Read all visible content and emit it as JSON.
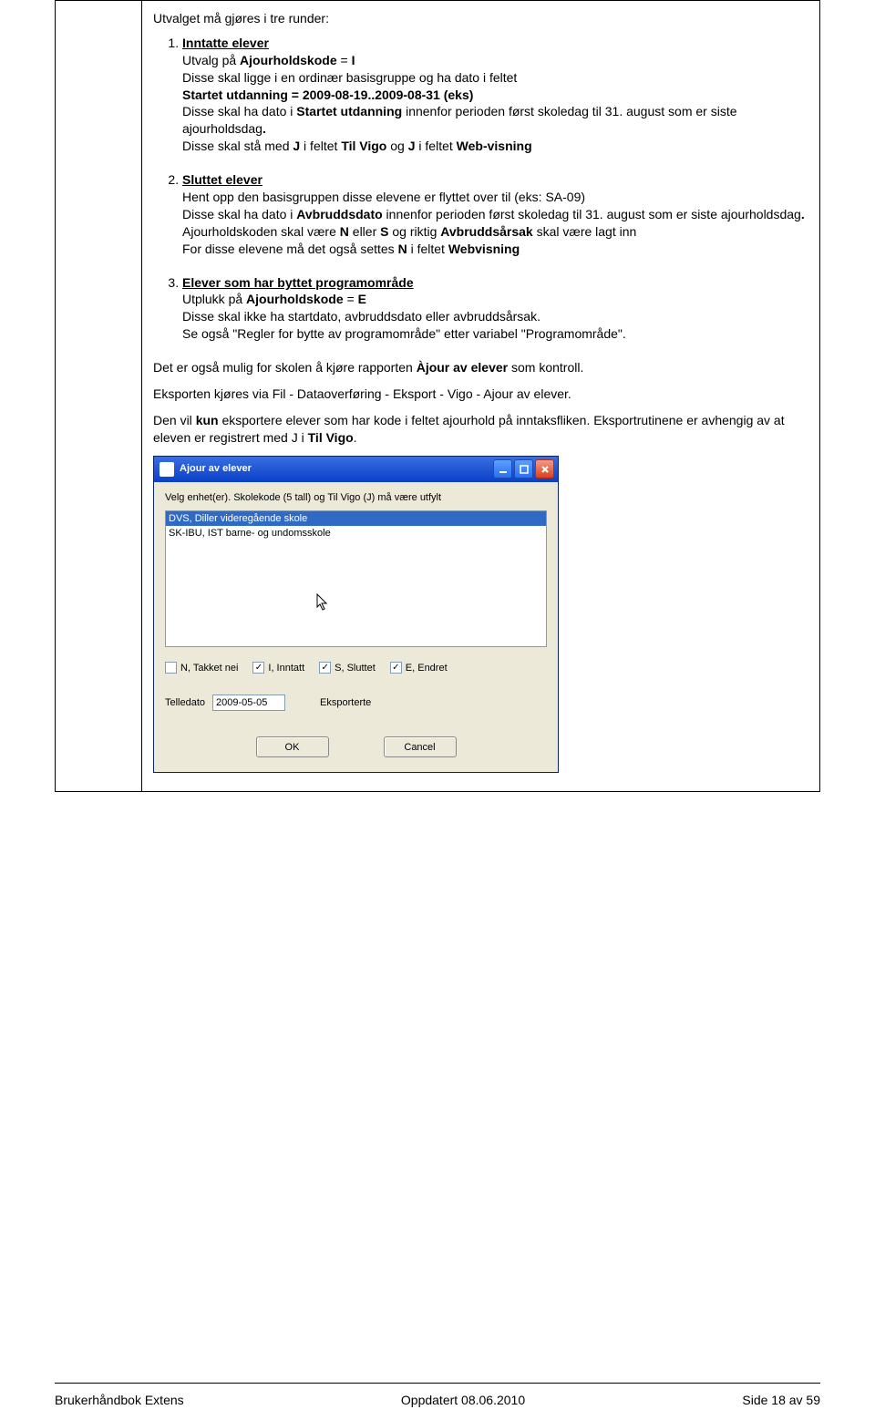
{
  "content": {
    "heading": "Utvalget må gjøres i tre runder:",
    "items": [
      {
        "title": "Inntatte elever",
        "lines": [
          "Utvalg på <b>Ajourholdskode</b>  =  <b>I</b>",
          "Disse skal ligge i en ordinær basisgruppe og ha dato i feltet",
          "<b>Startet utdanning = 2009-08-19..2009-08-31 (eks)</b>",
          "Disse skal ha dato i <b>Startet utdanning</b> innenfor perioden først skoledag til 31. august som er siste ajourholdsdag<b>.</b>",
          "Disse skal stå med <b>J</b> i feltet <b>Til Vigo</b> og <b>J</b> i feltet <b>Web-visning</b>"
        ]
      },
      {
        "title": "Sluttet elever",
        "lines": [
          "Hent opp den basisgruppen disse elevene er flyttet over til (eks: SA-09)",
          "Disse skal ha dato i <b>Avbruddsdato</b> innenfor perioden først skoledag til 31. august som er siste ajourholdsdag<b>.</b>",
          "Ajourholdskoden skal være <b>N</b> eller <b>S</b> og riktig <b>Avbruddsårsak</b> skal være lagt inn",
          "For disse elevene må det også settes <b>N</b> i feltet <b>Webvisning</b>"
        ]
      },
      {
        "title": "Elever som har byttet programområde",
        "lines": [
          "Utplukk på <b>Ajourholdskode</b>  =  <b>E</b>",
          "Disse skal ikke ha startdato, avbruddsdato eller avbruddsårsak.",
          "Se også \"Regler for bytte av programområde\" etter variabel \"Programområde\"."
        ]
      }
    ],
    "para1": "Det er også mulig for skolen å kjøre rapporten <b>Àjour av elever</b> som kontroll.",
    "para2": "Eksporten kjøres via Fil - Dataoverføring - Eksport - Vigo - Ajour av elever.",
    "para3": "Den vil <b>kun</b> eksportere elever som har kode i feltet ajourhold på inntaksfliken. Eksportrutinene er avhengig av at eleven er registrert med J i <b>Til Vigo</b>."
  },
  "dialog": {
    "title": "Ajour av elever",
    "instruction": "Velg enhet(er). Skolekode (5 tall) og Til Vigo (J) må være utfylt",
    "list": [
      "DVS, Diller videregående skole",
      "SK-IBU, IST barne- og undomsskole"
    ],
    "checks": [
      {
        "label": "N, Takket nei",
        "checked": false
      },
      {
        "label": "I, Inntatt",
        "checked": true
      },
      {
        "label": "S, Sluttet",
        "checked": true
      },
      {
        "label": "E, Endret",
        "checked": true
      }
    ],
    "telledato_label": "Telledato",
    "telledato_value": "2009-05-05",
    "eksporterte_label": "Eksporterte",
    "ok": "OK",
    "cancel": "Cancel"
  },
  "footer": {
    "left": "Brukerhåndbok Extens",
    "center": "Oppdatert  08.06.2010",
    "right": "Side 18  av 59"
  }
}
